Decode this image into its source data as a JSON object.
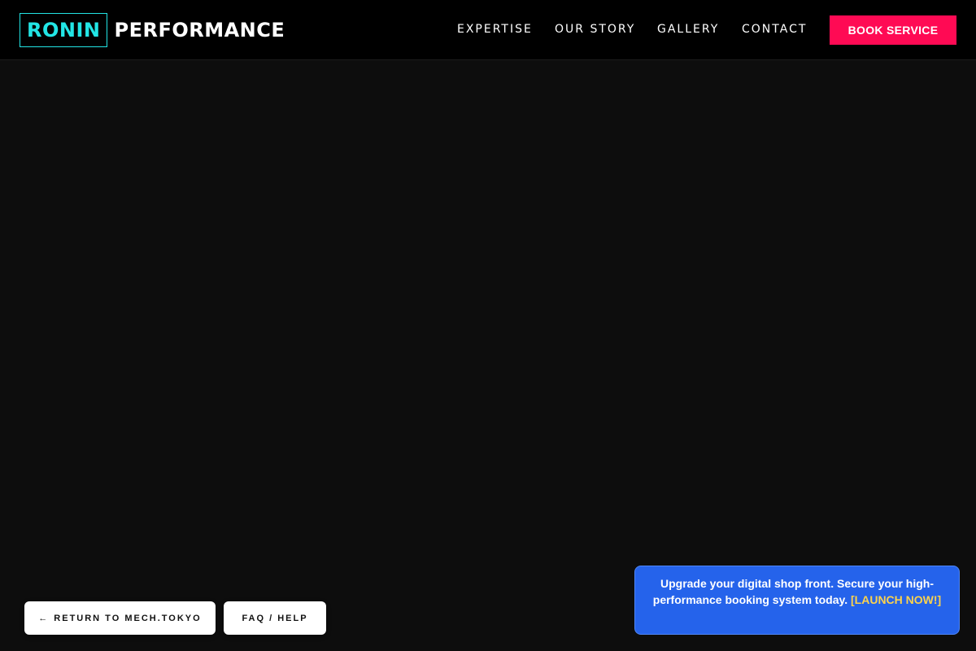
{
  "brand": {
    "logo_box": "RONIN",
    "logo_rest": "PERFORMANCE",
    "accent": "#22e5e5"
  },
  "nav": {
    "items": [
      {
        "label": "EXPERTISE"
      },
      {
        "label": "OUR STORY"
      },
      {
        "label": "GALLERY"
      },
      {
        "label": "CONTACT"
      }
    ],
    "cta_label": "BOOK SERVICE",
    "cta_color": "#ff0a54"
  },
  "footer_buttons": {
    "return_arrow": "←",
    "return_label": "RETURN TO MECH.TOKYO",
    "faq_label": "FAQ / HELP"
  },
  "promo": {
    "text": "Upgrade your digital shop front. Secure your high-performance booking system today.",
    "link_label": "[LAUNCH NOW!]",
    "background": "#2563eb",
    "link_color": "#fcd34d"
  }
}
